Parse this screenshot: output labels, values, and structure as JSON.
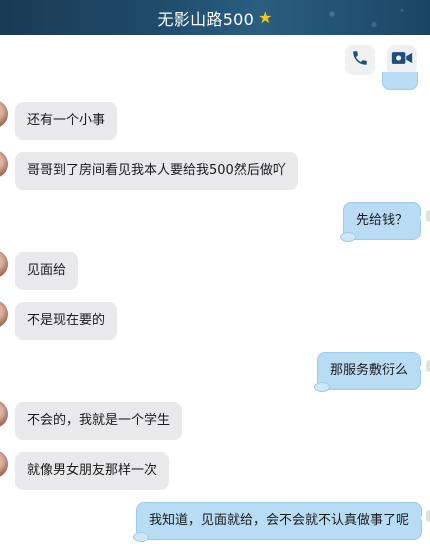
{
  "header": {
    "title": "无影山路500"
  },
  "icons": {
    "star": "star-icon",
    "phone": "phone-icon",
    "video": "video-camera-icon"
  },
  "colors": {
    "header_bg": "#1f4a6a",
    "incoming_bubble": "#e9e9eb",
    "outgoing_bubble": "#b9dcf5",
    "star": "#f5c518"
  },
  "messages": [
    {
      "direction": "incoming",
      "text": "还有一个小事"
    },
    {
      "direction": "incoming",
      "text": "哥哥到了房间看见我本人要给我500然后做吖"
    },
    {
      "direction": "outgoing",
      "text": "先给钱？"
    },
    {
      "direction": "incoming",
      "text": "见面给"
    },
    {
      "direction": "incoming",
      "text": "不是现在要的"
    },
    {
      "direction": "outgoing",
      "text": "那服务敷衍么"
    },
    {
      "direction": "incoming",
      "text": "不会的，我就是一个学生"
    },
    {
      "direction": "incoming",
      "text": "就像男女朋友那样一次"
    },
    {
      "direction": "outgoing",
      "text": "我知道，见面就给，会不会就不认真做事了呢"
    }
  ]
}
